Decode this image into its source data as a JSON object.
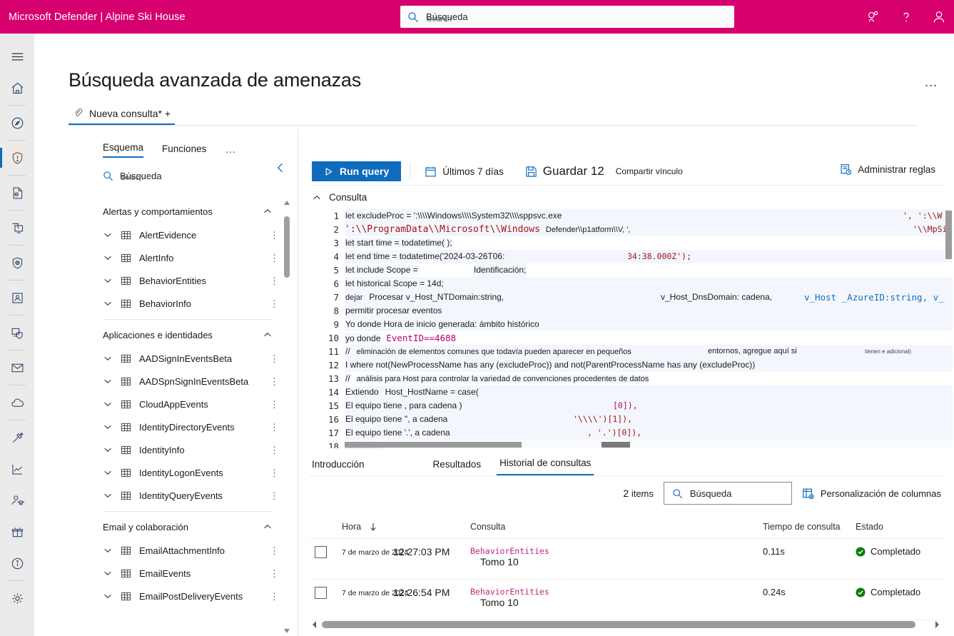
{
  "topbar": {
    "brand": "Microsoft Defender | Alpine Ski House",
    "search_value": "Búsqueda",
    "search_ghost": "Search",
    "icons": [
      "feedback-icon",
      "help-icon",
      "account-icon"
    ],
    "brand_color": "#d6006e"
  },
  "rail": {
    "items": [
      {
        "name": "hamburger-icon"
      },
      {
        "name": "home-icon"
      },
      {
        "name": "incidents-icon"
      },
      {
        "name": "hunting-shield-icon",
        "active": true
      },
      {
        "name": "actions-center-icon"
      },
      {
        "name": "device-inventory-icon"
      },
      {
        "name": "threat-analytics-icon"
      },
      {
        "name": "secure-score-icon"
      },
      {
        "name": "endpoints-icon"
      },
      {
        "name": "email-icon"
      },
      {
        "name": "cloud-apps-icon"
      },
      {
        "name": "tools-icon"
      },
      {
        "name": "reports-icon"
      },
      {
        "name": "learning-hub-icon"
      },
      {
        "name": "trials-icon"
      },
      {
        "name": "info-icon"
      },
      {
        "name": "settings-icon"
      }
    ]
  },
  "page": {
    "title": "Búsqueda avanzada de amenazas",
    "more_label": "…",
    "query_tab": "Nueva consulta* +"
  },
  "schema": {
    "tabs": [
      {
        "label": "Esquema",
        "active": true
      },
      {
        "label": "Funciones",
        "active": false
      }
    ],
    "more_label": "…",
    "search_value": "Búsqueda",
    "search_ghost": "Search",
    "sections": [
      {
        "title": "Alertas y comportamientos",
        "tables": [
          "AlertEvidence",
          "AlertInfo",
          "BehaviorEntities",
          "BehaviorInfo"
        ]
      },
      {
        "title": "Aplicaciones e identidades",
        "tables": [
          "AADSignInEventsBeta",
          "AADSpnSignInEventsBeta",
          "CloudAppEvents",
          "IdentityDirectoryEvents",
          "IdentityInfo",
          "IdentityLogonEvents",
          "IdentityQueryEvents"
        ]
      },
      {
        "title": "Email y colaboración",
        "tables": [
          "EmailAttachmentInfo",
          "EmailEvents",
          "EmailPostDeliveryEvents"
        ]
      }
    ]
  },
  "query_toolbar": {
    "run_label": "Run query",
    "timerange_label": "Últimos 7 días",
    "save_label": "Guardar 12",
    "share_label": "Compartir vínculo",
    "manage_rules_label": "Administrar reglas",
    "consulta_label": "Consulta"
  },
  "editor": {
    "line_numbers": [
      "1",
      "2",
      "3",
      "4",
      "5",
      "6",
      "7",
      "8",
      "9",
      "10",
      "11",
      "12",
      "13",
      "14",
      "15",
      "16",
      "17",
      "18"
    ],
    "lines": [
      {
        "n": 1,
        "main": "let excludeProc = ':\\\\\\\\Windows\\\\\\\\System32\\\\\\\\sppsvc.exe",
        "tail": "', ':\\\\W"
      },
      {
        "n": 2,
        "mono": "':\\\\ProgramData\\\\Microsoft\\\\Windows",
        "main2": "Defender\\\\p1atform\\\\V, ',",
        "tail": "'\\\\MpSi"
      },
      {
        "n": 3,
        "main": "let start time = todatetime( );"
      },
      {
        "n": 4,
        "main": "let end time = todatetime('2024-03-26T06:",
        "mono_tail": "34:38.000Z');"
      },
      {
        "n": 5,
        "main": "let include Scope =",
        "big": "Identificación;"
      },
      {
        "n": 6,
        "main": "let historical Scope = 14d;"
      },
      {
        "n": 7,
        "small": "dejar",
        "main": "Procesar v_Host_NTDomain:string,",
        "mid": "v_Host_DnsDomain: cadena,",
        "mono_tail": "v_Host _AzureID:string, v_"
      },
      {
        "n": 8,
        "main": "permitir procesar eventos"
      },
      {
        "n": 9,
        "main": "Yo donde   Hora de inicio generada: ámbito histórico"
      },
      {
        "n": 10,
        "big": "yo donde",
        "mono_kw": "EventID==4688"
      },
      {
        "n": 11,
        "comment": "//",
        "main": "eliminación de elementos comunes que todavía pueden aparecer en pequeños",
        "mid": "entornos, agregue aquí si",
        "tiny": "tienen e adicional)"
      },
      {
        "n": 12,
        "main": "I where not(NewProcessName has any (excludeProc)) and not(ParentProcessName has any (excludeProc))"
      },
      {
        "n": 13,
        "comment": "//",
        "main": "análisis para      Host para controlar la variedad de convenciones procedentes de datos"
      },
      {
        "n": 14,
        "big": "Extiendo",
        "main": "Host_HostName = case("
      },
      {
        "n": 15,
        "main": "El equipo tiene , para cadena )",
        "mono_tail": "[0]),"
      },
      {
        "n": 16,
        "main": "El equipo tiene '',            a cadena",
        "mono_tail": "'\\\\\\\\')[1]),"
      },
      {
        "n": 17,
        "main": "El equipo tiene    '.',  a cadena",
        "mono_tail": ", '.')[0]),"
      },
      {
        "n": 18,
        "main": "Computer"
      }
    ]
  },
  "results": {
    "tabs": [
      {
        "label": "Introducción",
        "active": false
      },
      {
        "label": "Resultados",
        "active": false
      },
      {
        "label": "Historial de consultas",
        "active": true
      }
    ],
    "items_count": "2",
    "items_label": "items",
    "search_value": "Búsqueda",
    "columns_label": "Personalización de columnas",
    "headers": {
      "time": "Hora",
      "query": "Consulta",
      "duration": "Tiempo de consulta",
      "state": "Estado"
    },
    "rows": [
      {
        "date": "7 de marzo de 2024",
        "time": "12:27:03 PM",
        "query_table": "BehaviorEntities",
        "query_take": "Tomo 10",
        "duration": "0.11s",
        "state": "Completado"
      },
      {
        "date": "7 de marzo de 2024",
        "time": "12:26:54 PM",
        "query_table": "BehaviorEntities",
        "query_take": "Tomo 10",
        "duration": "0.24s",
        "state": "Completado"
      }
    ]
  },
  "colors": {
    "brand": "#d6006e",
    "accent": "#0f6cbd",
    "success": "#107c10"
  }
}
